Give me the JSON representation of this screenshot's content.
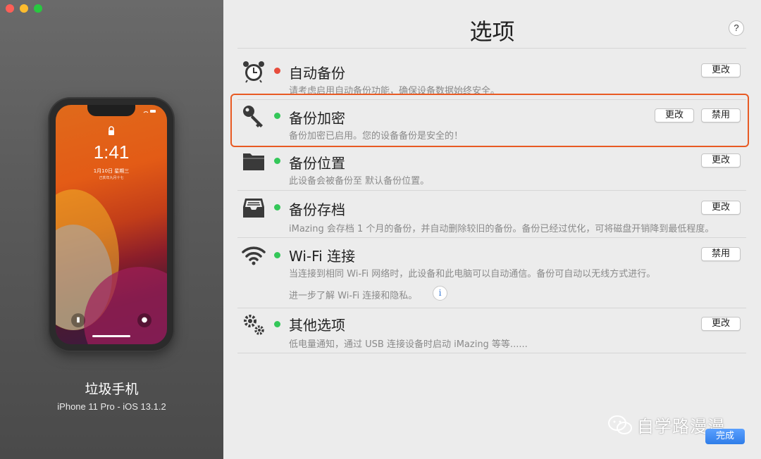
{
  "window": {
    "title": "选项",
    "help_label": "?"
  },
  "device": {
    "name": "垃圾手机",
    "model": "iPhone 11 Pro - iOS 13.1.2",
    "lockscreen": {
      "time": "1:41",
      "date": "1月10日 星期三",
      "lunar": "己亥年九月十七"
    }
  },
  "options": [
    {
      "id": "auto-backup",
      "title": "自动备份",
      "description": "请考虑启用自动备份功能，确保设备数据始终安全。",
      "status": "red",
      "buttons": [
        "更改"
      ],
      "icon": "alarm-clock-icon"
    },
    {
      "id": "backup-encryption",
      "title": "备份加密",
      "description": "备份加密已启用。您的设备备份是安全的！",
      "status": "green",
      "buttons": [
        "更改",
        "禁用"
      ],
      "icon": "key-icon"
    },
    {
      "id": "backup-location",
      "title": "备份位置",
      "description": "此设备会被备份至 默认备份位置。",
      "status": "green",
      "buttons": [
        "更改"
      ],
      "icon": "folder-icon"
    },
    {
      "id": "backup-archive",
      "title": "备份存档",
      "description": "iMazing 会存档 1 个月的备份，并自动删除较旧的备份。备份已经过优化，可将磁盘开销降到最低程度。",
      "status": "green",
      "buttons": [
        "更改"
      ],
      "icon": "archive-tray-icon"
    },
    {
      "id": "wifi",
      "title": "Wi-Fi 连接",
      "description": "当连接到相同 Wi-Fi 网络时，此设备和此电脑可以自动通信。备份可自动以无线方式进行。",
      "extra": "进一步了解 Wi-Fi 连接和隐私。",
      "status": "green",
      "buttons": [
        "禁用"
      ],
      "icon": "wifi-icon"
    },
    {
      "id": "other",
      "title": "其他选项",
      "description": "低电量通知，通过 USB 连接设备时启动 iMazing 等等......",
      "status": "green",
      "buttons": [
        "更改"
      ],
      "icon": "gears-icon"
    }
  ],
  "footer": {
    "done_label": "完成",
    "watermark": "自学路漫漫"
  },
  "colors": {
    "status_red": "#e74c3c",
    "status_green": "#34c759",
    "highlight": "#e85a23",
    "accent": "#2f7de8"
  }
}
